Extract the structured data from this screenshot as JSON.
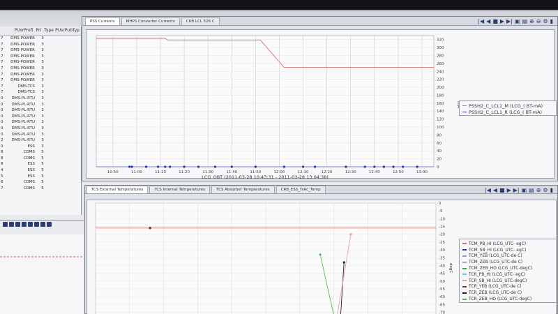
{
  "left_table": {
    "headers": [
      "PUsrProfi",
      "Pri",
      "Type",
      "PUsrPubTyp"
    ],
    "rows": [
      {
        "idx": "7",
        "name": "DMS-POWER",
        "pri": "3"
      },
      {
        "idx": "7",
        "name": "DMS-POWER",
        "pri": "3"
      },
      {
        "idx": "7",
        "name": "DMS-POWER",
        "pri": "3"
      },
      {
        "idx": "7",
        "name": "DMS-POWER",
        "pri": "3"
      },
      {
        "idx": "7",
        "name": "DMS-POWER",
        "pri": "3"
      },
      {
        "idx": "7",
        "name": "DMS-POWER",
        "pri": "3"
      },
      {
        "idx": "7",
        "name": "DMS-POWER",
        "pri": "3"
      },
      {
        "idx": "7",
        "name": "DMS-POWER",
        "pri": "3"
      },
      {
        "idx": "7",
        "name": "DMS-TCS",
        "pri": "3"
      },
      {
        "idx": "7",
        "name": "DMS-TCS",
        "pri": "3"
      },
      {
        "idx": "0",
        "name": "DMS-PL-RTU",
        "pri": "3"
      },
      {
        "idx": "0",
        "name": "DMS-PL-RTU",
        "pri": "3"
      },
      {
        "idx": "0",
        "name": "DMS-PL-RTU",
        "pri": "3"
      },
      {
        "idx": "0",
        "name": "DMS-PL-RTU",
        "pri": "3"
      },
      {
        "idx": "0",
        "name": "DMS-PL-RTU",
        "pri": "3"
      },
      {
        "idx": "0",
        "name": "DMS-PL-RTU",
        "pri": "3"
      },
      {
        "idx": "0",
        "name": "DMS-PL-RTU",
        "pri": "3"
      },
      {
        "idx": "2",
        "name": "DMS-PL-RTU",
        "pri": "3"
      },
      {
        "idx": "0",
        "name": "ESS",
        "pri": "3"
      },
      {
        "idx": "8",
        "name": "CDMS",
        "pri": "5"
      },
      {
        "idx": "8",
        "name": "CDMS",
        "pri": "5"
      },
      {
        "idx": "8",
        "name": "ESS",
        "pri": "5"
      },
      {
        "idx": "4",
        "name": "ESS",
        "pri": "5"
      },
      {
        "idx": "5",
        "name": "ESS",
        "pri": "5"
      },
      {
        "idx": "6",
        "name": "CDMS",
        "pri": "5"
      },
      {
        "idx": "7",
        "name": "CDMS",
        "pri": "5"
      }
    ]
  },
  "top_window": {
    "tabs": [
      "PSS Currents",
      "MHPS Converter Currents",
      "CRB LCL 526 C"
    ],
    "legend": [
      {
        "label": "PSSH2_C_LCL1_M (LCG_( BT-mA)",
        "color": "#e07070"
      },
      {
        "label": "PSSH2_C_LCL1_R (LCG_( BT-mA)",
        "color": "#2233aa"
      }
    ]
  },
  "bottom_window": {
    "tabs": [
      "TCS External Temperatures",
      "TCS Internal Temperatures",
      "TCS Absorber Temperatures",
      "CRB_ESS_TsRc_Temp"
    ],
    "legend": [
      {
        "label": "TCM_PB_HI (LCG_UTC- egC)",
        "color": "#e07070"
      },
      {
        "label": "TCM_SB_HI (LCG_UTC- egC)",
        "color": "#2233aa"
      },
      {
        "label": "TCM_YEB (LCG_UTC-de C)",
        "color": "#9999cc"
      },
      {
        "label": "TCM_ZEB (LCG_UTC-de C)",
        "color": "#aaaaaa"
      },
      {
        "label": "TCM_ZEB_HO (LCG_UTC-degC)",
        "color": "#44aa44"
      },
      {
        "label": "TCR_PB_HI (LCG_UTC- egC)",
        "color": "#66cccc"
      },
      {
        "label": "TCR_SB_HI (LCG_UTC-degC)",
        "color": "#e0a0a0"
      },
      {
        "label": "TCR_YEB (LCG_UTC-de C)",
        "color": "#883333"
      },
      {
        "label": "TCR_ZEB (LCG_UTC-de C)",
        "color": "#222222"
      },
      {
        "label": "TCR_ZEB_HO (LCG_UTC-degC)",
        "color": "#55bb55"
      }
    ]
  },
  "chart_data": [
    {
      "type": "line",
      "xlabel": "LCG_OBT (2011-03-28 10:43:31 - 2011-03-28 13:04:38)",
      "ylabel": "mA",
      "x_ticks": [
        "10:50",
        "11:00",
        "11:10",
        "11:20",
        "11:30",
        "11:40",
        "11:50",
        "12:00",
        "12:10",
        "12:20",
        "12:30",
        "12:40",
        "12:50",
        "13:00"
      ],
      "y_ticks": [
        0,
        20,
        40,
        60,
        80,
        100,
        120,
        140,
        160,
        180,
        200,
        220,
        240,
        260,
        280,
        300,
        320
      ],
      "ylim": [
        0,
        330
      ],
      "xlim_minutes": [
        643,
        785
      ],
      "series": [
        {
          "name": "PSSH2_C_LCL1_M (LCG_( BT-mA)",
          "points": [
            [
              643,
              323
            ],
            [
              672,
              323
            ],
            [
              673,
              319
            ],
            [
              712,
              319
            ],
            [
              722,
              250
            ],
            [
              785,
              250
            ]
          ]
        },
        {
          "name": "PSSH2_C_LCL1_R (LCG_( BT-mA)",
          "points": [
            [
              643,
              0
            ],
            [
              785,
              0
            ]
          ],
          "markers": [
            657,
            658,
            664,
            669,
            672,
            674,
            680,
            686,
            693,
            700,
            710,
            722,
            730,
            735,
            748,
            756,
            760,
            764,
            768,
            772,
            778
          ]
        }
      ]
    },
    {
      "type": "line",
      "ylabel": "degC",
      "y_ticks": [
        0,
        -5,
        -10,
        -15,
        -20,
        -25,
        -30,
        -35,
        -40,
        -45,
        -50,
        -55,
        -60,
        -65,
        -70
      ],
      "ylim": [
        -72,
        0
      ],
      "series": [
        {
          "name": "TCM_PB_HI (LCG_UTC- egC)",
          "points": [
            [
              0,
              -16
            ],
            [
              100,
              -16
            ]
          ],
          "markers": [
            16
          ]
        },
        {
          "name": "TCR_ZEB_HO (LCG_UTC-degC)",
          "points": [
            [
              66,
              -33
            ],
            [
              70,
              -72
            ]
          ]
        },
        {
          "name": "TCR_ZEB (LCG_UTC-de C)",
          "points": [
            [
              73,
              -38
            ],
            [
              72,
              -72
            ]
          ]
        },
        {
          "name": "TCR_SB_HI (LCG_UTC-degC)",
          "points": [
            [
              75,
              -20
            ],
            [
              71,
              -72
            ]
          ]
        }
      ]
    }
  ]
}
